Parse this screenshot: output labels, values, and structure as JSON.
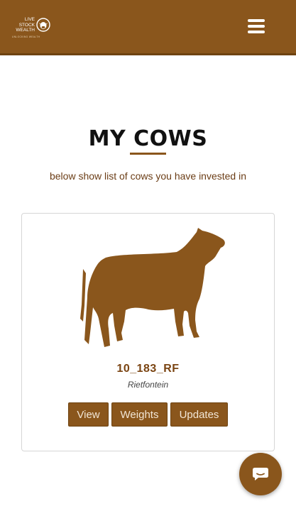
{
  "header": {
    "logo": {
      "lines": [
        "LIVE",
        "STOCK",
        "WEALTH"
      ],
      "tagline": "UNLOCKING WEALTH"
    },
    "menu_icon": "hamburger-menu-icon"
  },
  "main": {
    "title": "MY COWS",
    "subtitle": "below show list of cows you have invested in"
  },
  "cows": [
    {
      "id": "10_183_RF",
      "farm": "Rietfontein",
      "actions": {
        "view": "View",
        "weights": "Weights",
        "updates": "Updates"
      }
    }
  ],
  "chat": {
    "icon": "chat-bubble-icon"
  },
  "colors": {
    "brand": "#8a561c",
    "brand_dark": "#6e4311",
    "cow_id_text": "#7a4412"
  }
}
